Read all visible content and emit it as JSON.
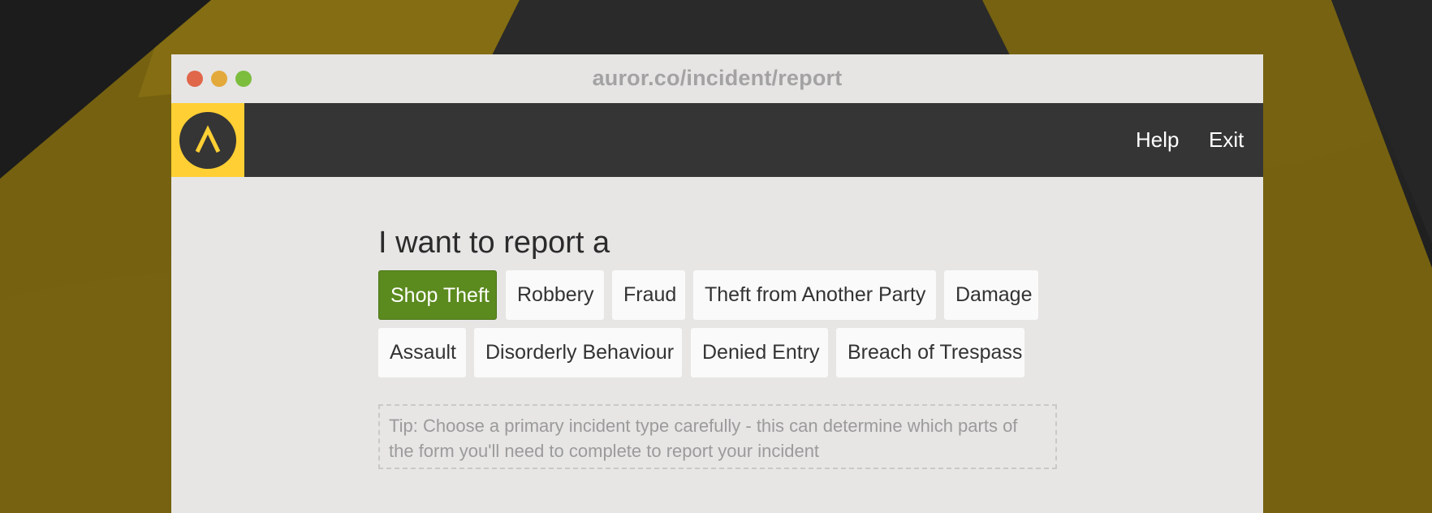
{
  "browser": {
    "url": "auror.co/incident/report"
  },
  "navbar": {
    "logo_icon": "caret-up-logo-icon",
    "links": [
      "Help",
      "Exit"
    ]
  },
  "main": {
    "heading": "I want to report a",
    "incident_types": [
      {
        "label": "Shop Theft",
        "selected": true
      },
      {
        "label": "Robbery",
        "selected": false
      },
      {
        "label": "Fraud",
        "selected": false
      },
      {
        "label": "Theft from Another Party",
        "selected": false
      },
      {
        "label": "Damage",
        "selected": false
      },
      {
        "label": "Assault",
        "selected": false
      },
      {
        "label": "Disorderly Behaviour",
        "selected": false
      },
      {
        "label": "Denied Entry",
        "selected": false
      },
      {
        "label": "Breach of Trespass",
        "selected": false
      }
    ],
    "tip": "Tip: Choose a primary incident type carefully - this can determine which parts of the form you'll need to complete to report your incident"
  },
  "colors": {
    "accent_yellow": "#ffcf33",
    "selected_green": "#5b8a1e",
    "navbar": "#353535"
  }
}
